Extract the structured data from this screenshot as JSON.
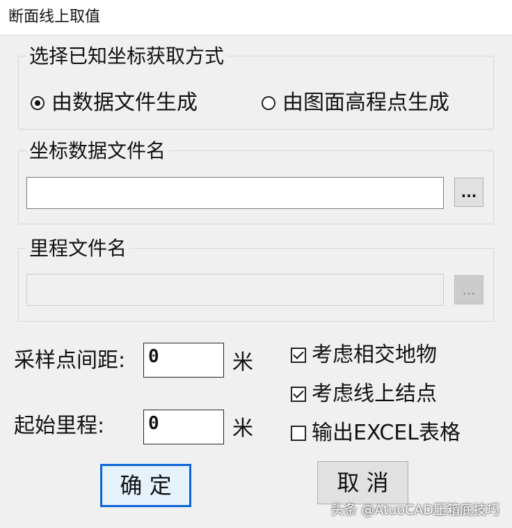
{
  "window": {
    "title": "断面线上取值"
  },
  "method_group": {
    "label": "选择已知坐标获取方式",
    "options": [
      {
        "label": "由数据文件生成",
        "checked": true
      },
      {
        "label": "由图面高程点生成",
        "checked": false
      }
    ]
  },
  "coord_file_group": {
    "label": "坐标数据文件名",
    "value": "",
    "browse_label": "..."
  },
  "mileage_file_group": {
    "label": "里程文件名",
    "value": "",
    "browse_label": "..."
  },
  "sampling": {
    "label": "采样点间距:",
    "value": "0",
    "unit": "米"
  },
  "start_mileage": {
    "label": "起始里程:",
    "value": "0",
    "unit": "米"
  },
  "options": [
    {
      "label": "考虑相交地物",
      "checked": true
    },
    {
      "label": "考虑线上结点",
      "checked": true
    },
    {
      "label": "输出EXCEL表格",
      "checked": false
    }
  ],
  "buttons": {
    "ok": "确  定",
    "cancel": "取  消"
  },
  "watermark": "头条 @AtuoCAD压箱底技巧"
}
